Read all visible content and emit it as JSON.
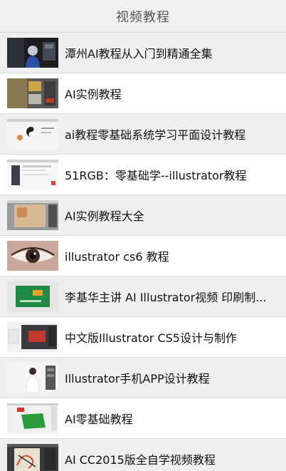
{
  "header": {
    "title": "视频教程"
  },
  "videos": [
    {
      "title": "潭州AI教程从入门到精通全集",
      "thumb_icon": "blue-character-illustration-thumbnail"
    },
    {
      "title": "AI实例教程",
      "thumb_icon": "gold-texture-screenshot-thumbnail"
    },
    {
      "title": "ai教程零基础系统学习平面设计教程",
      "thumb_icon": "yin-yang-design-thumbnail"
    },
    {
      "title": "51RGB：零基础学--illustrator教程",
      "thumb_icon": "software-window-thumbnail"
    },
    {
      "title": "AI实例教程大全",
      "thumb_icon": "tan-artboard-thumbnail"
    },
    {
      "title": "illustrator cs6 教程",
      "thumb_icon": "eye-closeup-thumbnail"
    },
    {
      "title": "李基华主讲 AI Illustrator视频 印刷制...",
      "thumb_icon": "green-card-design-thumbnail"
    },
    {
      "title": "中文版Illustrator CS5设计与制作",
      "thumb_icon": "dark-interface-thumbnail"
    },
    {
      "title": "Illustrator手机APP设计教程",
      "thumb_icon": "presenter-thumbnail"
    },
    {
      "title": "AI零基础教程",
      "thumb_icon": "green-shape-thumbnail"
    },
    {
      "title": "AI CC2015版全自学视频教程",
      "thumb_icon": "sketch-artwork-thumbnail"
    }
  ]
}
